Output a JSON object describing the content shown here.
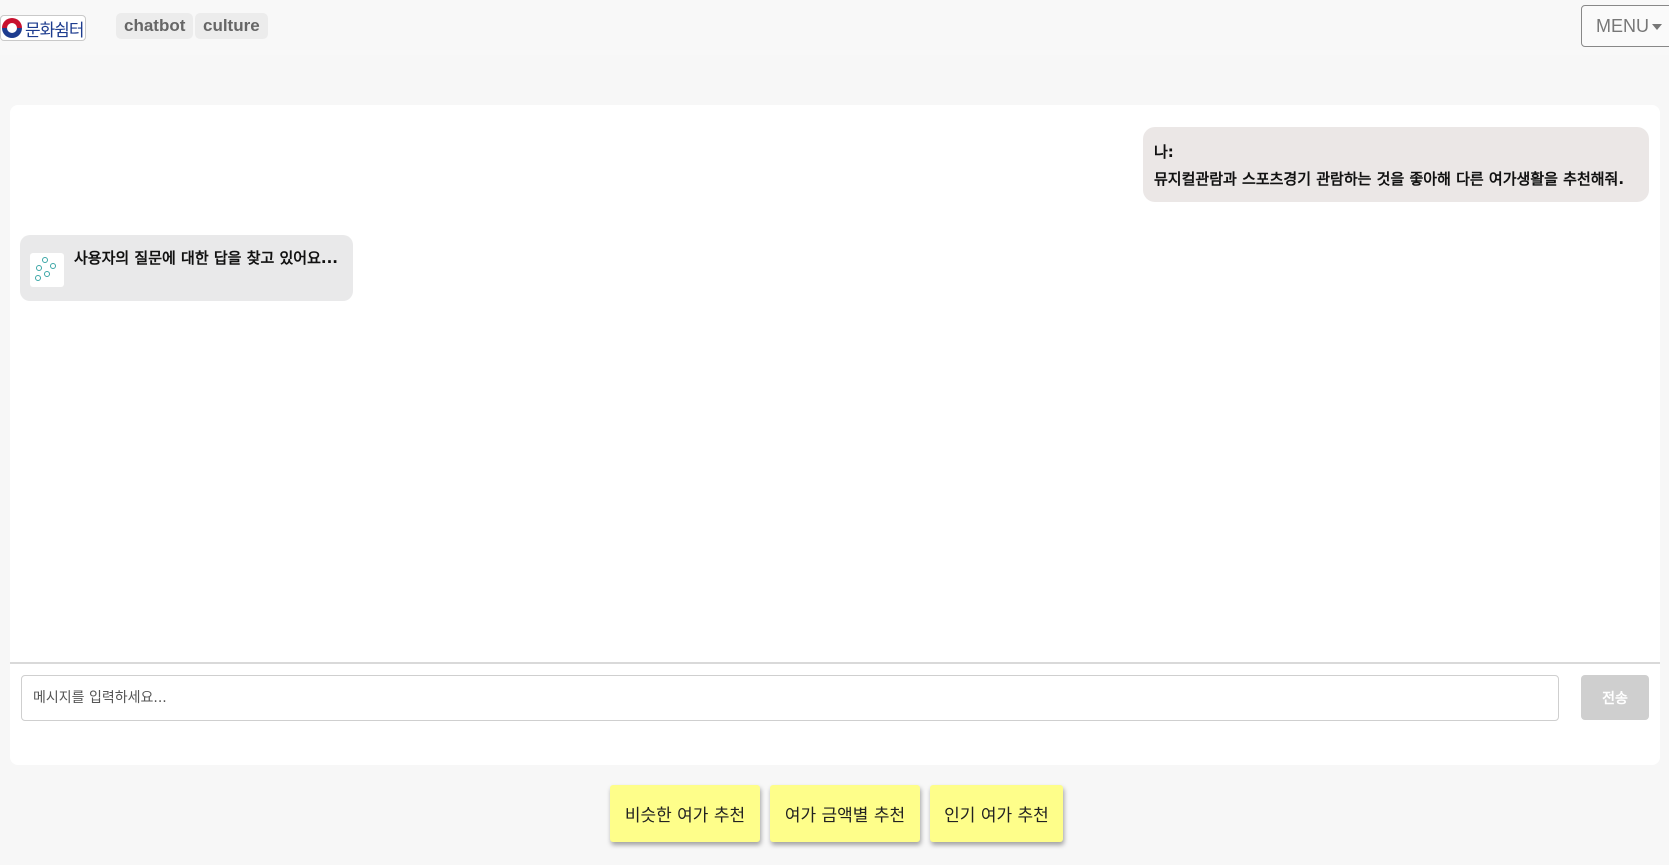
{
  "header": {
    "logo_text": "문화쉼터",
    "nav": [
      {
        "label": "chatbot"
      },
      {
        "label": "culture"
      }
    ],
    "menu_label": "MENU"
  },
  "chat": {
    "user_message": {
      "sender": "나:",
      "text": "뮤지컬관람과 스포츠경기 관람하는 것을 좋아해 다른 여가생활을 추천해줘."
    },
    "bot_message": {
      "text": "사용자의 질문에 대한 답을 찾고 있어요..."
    },
    "input": {
      "placeholder": "메시지를 입력하세요..."
    },
    "send_label": "전송"
  },
  "recommend_buttons": [
    {
      "label": "비슷한 여가 추천"
    },
    {
      "label": "여가 금액별 추천"
    },
    {
      "label": "인기 여가 추천"
    }
  ],
  "colors": {
    "page_bg": "#f7f7f7",
    "user_bubble": "#ebe7e6",
    "bot_bubble": "#e9e9ea",
    "rec_button": "#fefe8a",
    "send_disabled": "#cfcfcf"
  }
}
